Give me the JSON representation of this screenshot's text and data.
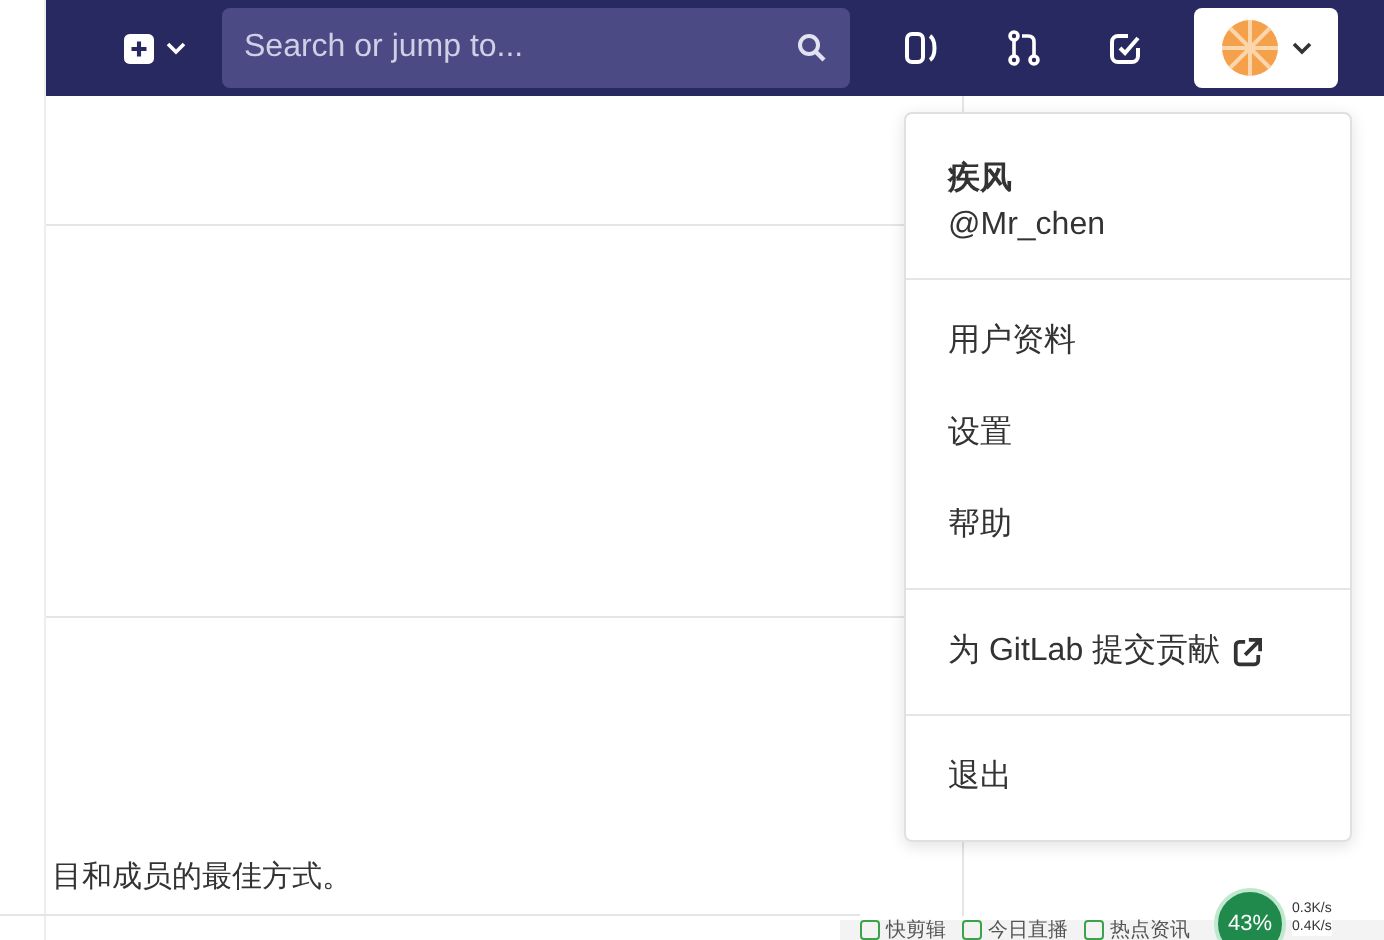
{
  "header": {
    "search": {
      "placeholder": "Search or jump to..."
    }
  },
  "user_menu": {
    "name": "疾风",
    "username": "@Mr_chen",
    "items": [
      {
        "label": "用户资料",
        "kind": "link"
      },
      {
        "label": "设置",
        "kind": "link"
      },
      {
        "label": "帮助",
        "kind": "link"
      },
      {
        "label": "为 GitLab 提交贡献",
        "kind": "external"
      },
      {
        "label": "退出",
        "kind": "link"
      }
    ]
  },
  "page": {
    "text": "目和成员的最佳方式。"
  },
  "browser_bar": {
    "items": [
      "快剪辑",
      "今日直播",
      "热点资讯"
    ],
    "cpu": "43%",
    "upload": "0.3K/s",
    "download": "0.4K/s"
  }
}
